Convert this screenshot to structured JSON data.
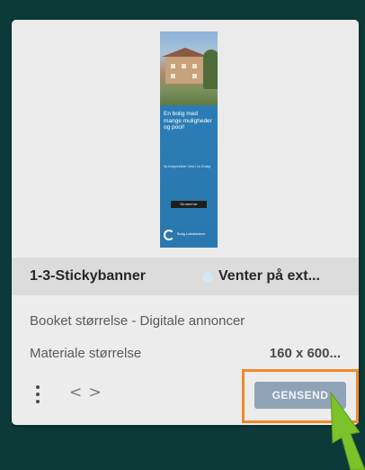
{
  "card": {
    "banner_preview": {
      "headline": "En bolig med mange muligheder og pool!",
      "small_text": "Ny boligområde i Vest • nu til salg",
      "cta": "Se mere her",
      "logo_text": "Bolig Lokalavisen"
    },
    "title": "1-3-Stickybanner",
    "status": "Venter på ext...",
    "booked_size_label": "Booket størrelse - Digitale annoncer",
    "material_size_label": "Materiale størrelse",
    "material_size_value": "160 x 600...",
    "resend_label": "GENSEND"
  },
  "colors": {
    "background": "#0d3a38",
    "card": "#ececec",
    "title_bar": "#dcdcdc",
    "button": "#8fa3b6",
    "highlight": "#f08a2a",
    "pointer": "#7cc22a"
  },
  "icons": {
    "menu": "vertical-ellipsis-icon",
    "embed": "code-brackets-icon",
    "status": "status-dot-icon"
  }
}
